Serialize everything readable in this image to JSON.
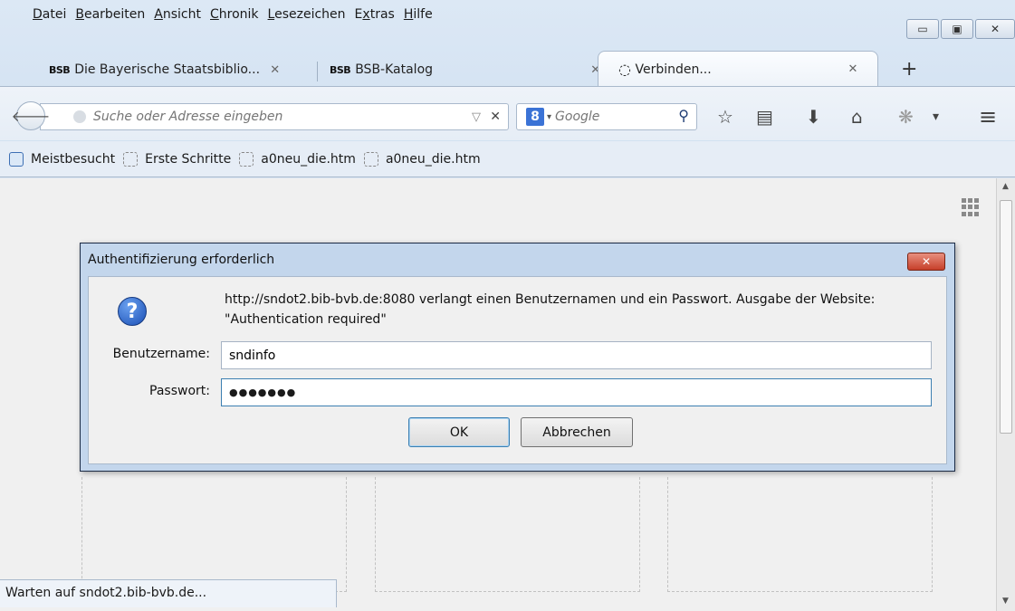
{
  "menu": [
    {
      "pre": "",
      "key": "D",
      "post": "atei"
    },
    {
      "pre": "",
      "key": "B",
      "post": "earbeiten"
    },
    {
      "pre": "",
      "key": "A",
      "post": "nsicht"
    },
    {
      "pre": "",
      "key": "C",
      "post": "hronik"
    },
    {
      "pre": "",
      "key": "L",
      "post": "esezeichen"
    },
    {
      "pre": "E",
      "key": "x",
      "post": "tras"
    },
    {
      "pre": "",
      "key": "H",
      "post": "ilfe"
    }
  ],
  "window_controls": {
    "minimize": "▭",
    "maximize": "▣",
    "close": "✕"
  },
  "tabs": [
    {
      "favicon": "BSB",
      "title": "Die Bayerische Staatsbiblio...",
      "close": "✕"
    },
    {
      "favicon": "BSB",
      "title": "BSB-Katalog",
      "close": "✕"
    },
    {
      "favicon": "◌",
      "title": "Verbinden...",
      "close": "✕"
    }
  ],
  "new_tab": "+",
  "navbar": {
    "back": "🡐",
    "url_placeholder": "Suche oder Adresse eingeben",
    "dropdown": "▽",
    "clear": "✕",
    "search_engine_icon": "8",
    "search_caret": "▾",
    "search_placeholder": "Google",
    "search_icon": "⚲",
    "bookmark_star": "☆",
    "reading_list": "▤",
    "download": "⬇",
    "home": "⌂",
    "addon": "❋",
    "addon_caret": "▾",
    "menu": "≡"
  },
  "bookmarks": [
    "Meistbesucht",
    "Erste Schritte",
    "a0neu_die.htm",
    "a0neu_die.htm"
  ],
  "status_text": "Warten auf sndot2.bib-bvb.de...",
  "dialog": {
    "title": "Authentifizierung erforderlich",
    "close": "✕",
    "icon": "?",
    "message": "http://sndot2.bib-bvb.de:8080 verlangt einen Benutzernamen und ein Passwort. Ausgabe der Website: \"Authentication required\"",
    "username_label": "Benutzername:",
    "username_value": "sndinfo",
    "password_label": "Passwort:",
    "password_value": "●●●●●●●",
    "ok": "OK",
    "cancel": "Abbrechen"
  },
  "scrollbar": {
    "up": "▲",
    "down": "▼"
  }
}
